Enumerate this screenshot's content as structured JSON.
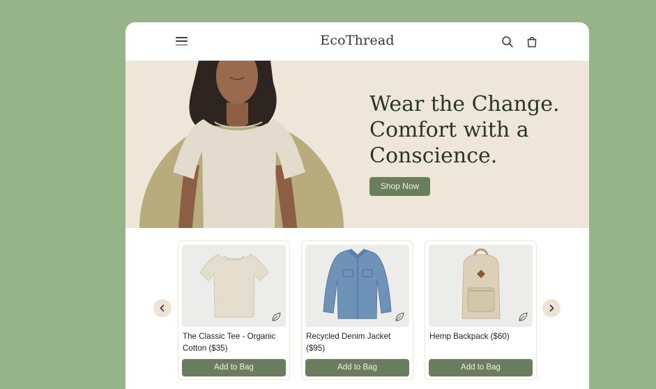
{
  "header": {
    "logo": "EcoThread",
    "icons": [
      "menu-icon",
      "search-icon",
      "shopping-bag-icon"
    ]
  },
  "hero": {
    "title_lines": [
      "Wear the Change.",
      "Comfort with a",
      "Conscience."
    ],
    "cta_label": "Shop Now"
  },
  "products": [
    {
      "name": "The Classic Tee - Organic Cotton ($35)",
      "button": "Add to Bag",
      "icon": "leaf-icon"
    },
    {
      "name": "Recycled Denim Jacket ($95)",
      "button": "Add to Bag",
      "icon": "leaf-icon"
    },
    {
      "name": "Hemp Backpack ($60)",
      "button": "Add to Bag",
      "icon": "leaf-icon"
    }
  ],
  "carousel": {
    "prev_icon": "chevron-left-icon",
    "next_icon": "chevron-right-icon"
  },
  "colors": {
    "background": "#97b389",
    "hero_background": "#efe6da",
    "accent": "#6a7d5c",
    "arrow_background": "#ede4d6"
  }
}
